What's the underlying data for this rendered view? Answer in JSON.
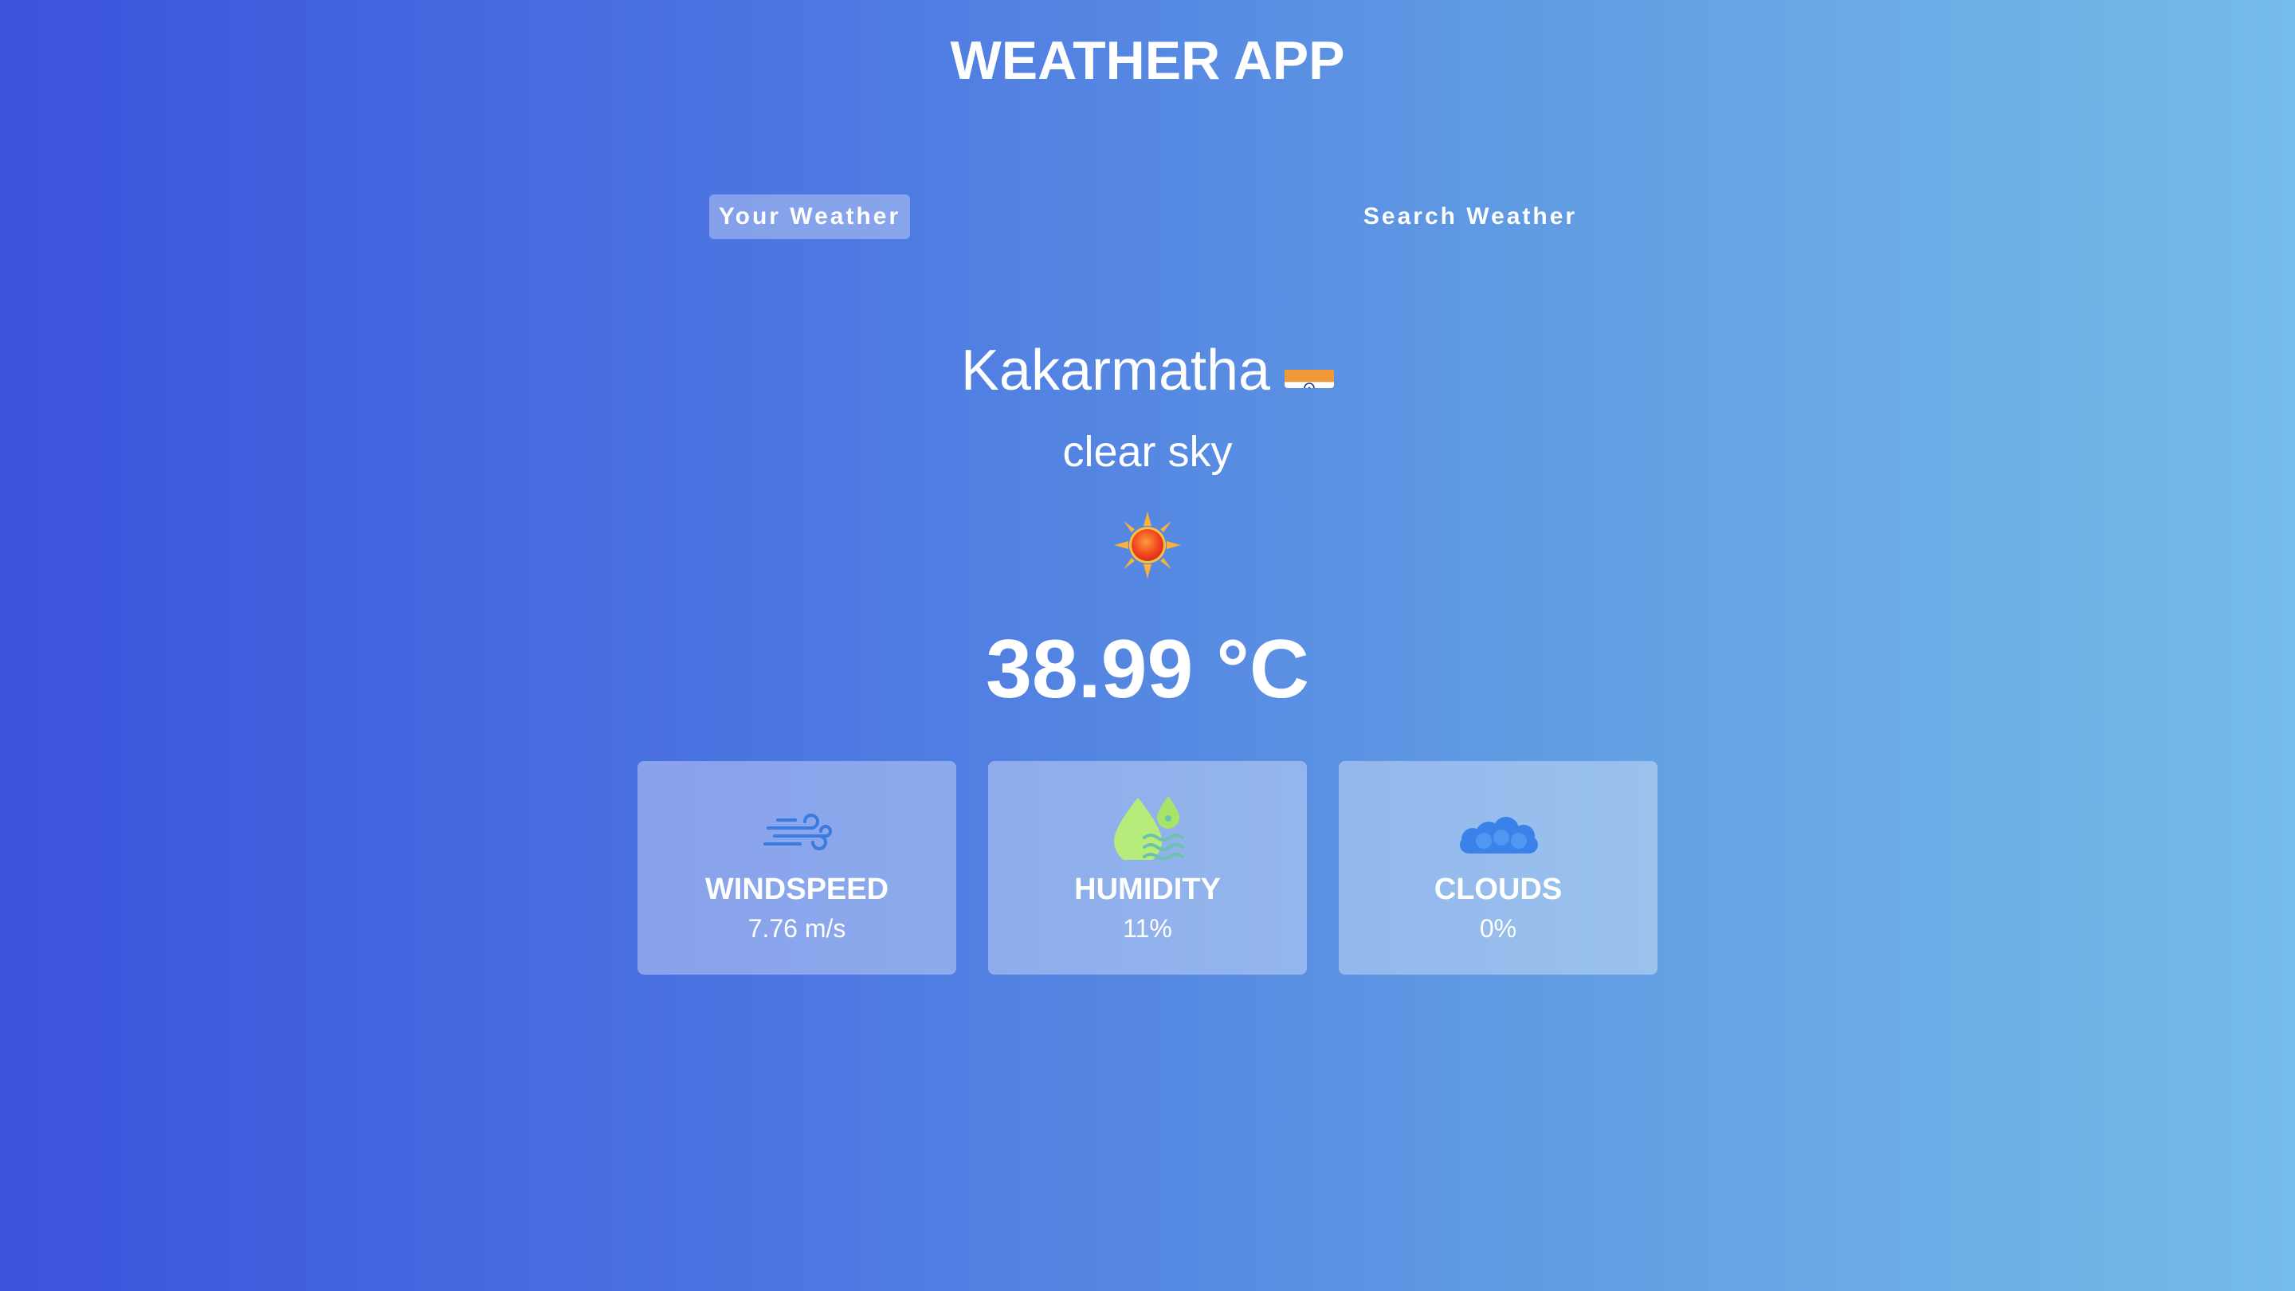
{
  "app": {
    "title": "WEATHER APP"
  },
  "tabs": [
    {
      "label": "Your Weather",
      "active": true
    },
    {
      "label": "Search Weather",
      "active": false
    }
  ],
  "location": {
    "city": "Kakarmatha",
    "flag_icon": "india-flag-icon"
  },
  "weather": {
    "description": "clear sky",
    "icon": "sun-icon",
    "temperature": "38.99 °C"
  },
  "cards": [
    {
      "icon": "wind-icon",
      "label": "WINDSPEED",
      "value": "7.76 m/s"
    },
    {
      "icon": "humidity-icon",
      "label": "HUMIDITY",
      "value": "11%"
    },
    {
      "icon": "cloud-icon",
      "label": "CLOUDS",
      "value": "0%"
    }
  ],
  "colors": {
    "gradient_start": "#3c53dc",
    "gradient_end": "#74bce9",
    "text": "#ffffff"
  }
}
